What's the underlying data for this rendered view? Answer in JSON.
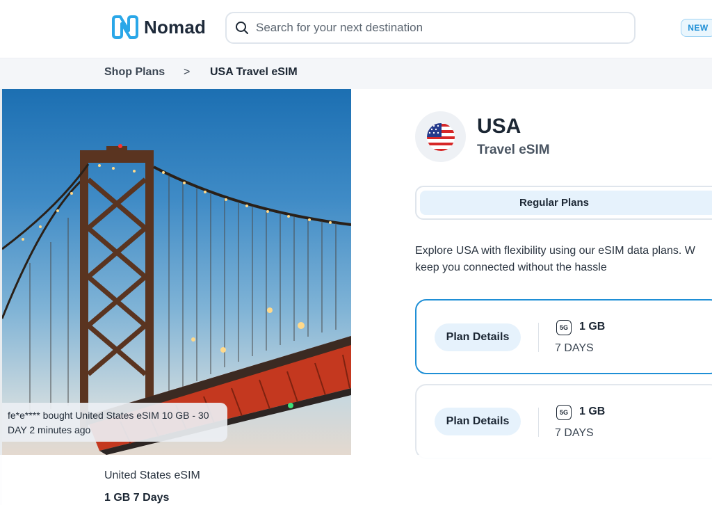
{
  "header": {
    "brand": "Nomad",
    "search_placeholder": "Search for your next destination",
    "badge": "NEW"
  },
  "breadcrumb": {
    "items": [
      "Shop Plans",
      "USA Travel eSIM"
    ],
    "separator": ">"
  },
  "hero": {
    "toast": "fe*e**** bought United States eSIM 10 GB - 30 DAY 2 minutes ago"
  },
  "product": {
    "country": "USA",
    "subtitle": "Travel eSIM",
    "tab_active": "Regular Plans",
    "description_line1": "Explore USA with flexibility using our eSIM data plans. W",
    "description_line2": "keep you connected without the hassle"
  },
  "plans": [
    {
      "button": "Plan Details",
      "network": "5G",
      "data": "1 GB",
      "duration": "7 DAYS",
      "selected": true
    },
    {
      "button": "Plan Details",
      "network": "5G",
      "data": "1 GB",
      "duration": "7 DAYS",
      "selected": false
    }
  ],
  "summary": {
    "name": "United States eSIM",
    "plan": "1 GB 7 Days"
  },
  "colors": {
    "accent": "#1f8fd6",
    "tab_bg": "#e6f2fc",
    "breadcrumb_bg": "#f4f6f9",
    "text_dark": "#1b2633"
  }
}
